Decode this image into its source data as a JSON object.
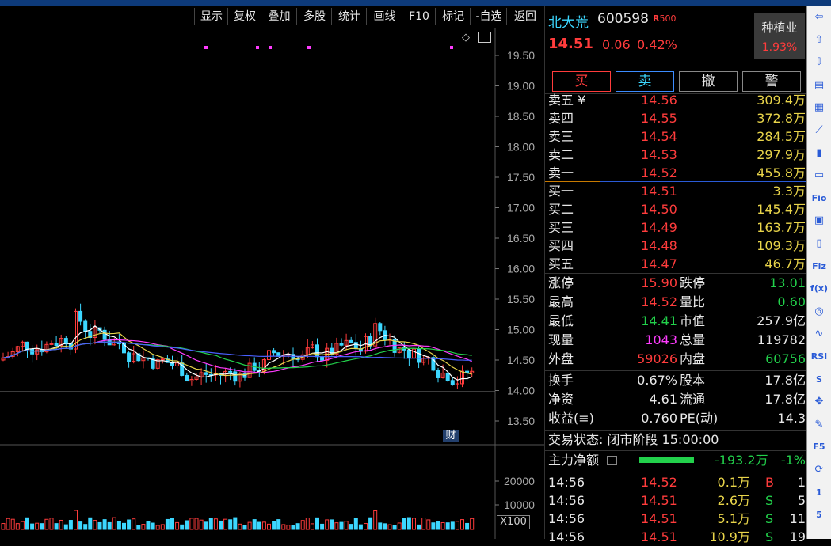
{
  "toolbar": [
    "显示",
    "复权",
    "叠加",
    "多股",
    "统计",
    "画线",
    "F10",
    "标记",
    "-自选",
    "返回"
  ],
  "price_axis": [
    "19.50",
    "19.00",
    "18.50",
    "18.00",
    "17.50",
    "17.00",
    "16.50",
    "16.00",
    "15.50",
    "15.00",
    "14.50",
    "14.00",
    "13.50"
  ],
  "volume_axis": [
    "20000",
    "10000"
  ],
  "volume_unit": "X100",
  "finance_tag": "财",
  "stock": {
    "name": "北大荒",
    "code": "600598",
    "badge": "R",
    "badge_num": "500",
    "price": "14.51",
    "change": "0.06",
    "pct": "0.42%"
  },
  "sector": {
    "name": "种植业",
    "pct": "1.93%"
  },
  "buttons": {
    "buy": "买",
    "sell": "卖",
    "cancel": "撤",
    "alert": "警"
  },
  "asks": [
    {
      "label": "卖五 ¥",
      "price": "14.56",
      "vol": "309.4万"
    },
    {
      "label": "卖四",
      "price": "14.55",
      "vol": "372.8万"
    },
    {
      "label": "卖三",
      "price": "14.54",
      "vol": "284.5万"
    },
    {
      "label": "卖二",
      "price": "14.53",
      "vol": "297.9万"
    },
    {
      "label": "卖一",
      "price": "14.52",
      "vol": "455.8万"
    }
  ],
  "bids": [
    {
      "label": "买一",
      "price": "14.51",
      "vol": "3.3万"
    },
    {
      "label": "买二",
      "price": "14.50",
      "vol": "145.4万"
    },
    {
      "label": "买三",
      "price": "14.49",
      "vol": "163.7万"
    },
    {
      "label": "买四",
      "price": "14.48",
      "vol": "109.3万"
    },
    {
      "label": "买五",
      "price": "14.47",
      "vol": "46.7万"
    }
  ],
  "stats": [
    {
      "l1": "涨停",
      "v1": "15.90",
      "c1": "red",
      "l2": "跌停",
      "v2": "13.01",
      "c2": "green"
    },
    {
      "l1": "最高",
      "v1": "14.52",
      "c1": "red",
      "l2": "量比",
      "v2": "0.60",
      "c2": "green"
    },
    {
      "l1": "最低",
      "v1": "14.41",
      "c1": "green",
      "l2": "市值",
      "v2": "257.9亿",
      "c2": "white"
    },
    {
      "l1": "现量",
      "v1": "1043",
      "c1": "magenta",
      "l2": "总量",
      "v2": "119782",
      "c2": "white"
    },
    {
      "l1": "外盘",
      "v1": "59026",
      "c1": "red",
      "l2": "内盘",
      "v2": "60756",
      "c2": "green"
    }
  ],
  "stats2": [
    {
      "l1": "换手",
      "v1": "0.67%",
      "l2": "股本",
      "v2": "17.8亿"
    },
    {
      "l1": "净资",
      "v1": "4.61",
      "l2": "流通",
      "v2": "17.8亿"
    },
    {
      "l1": "收益(≡)",
      "v1": "0.760",
      "l2": "PE(动)",
      "v2": "14.3"
    }
  ],
  "trade_status": "交易状态: 闭市阶段 15:00:00",
  "main_flow": {
    "label": "主力净额",
    "value": "-193.2万",
    "pct": "-1%"
  },
  "ticks": [
    {
      "time": "14:56",
      "price": "14.52",
      "vol": "0.1万",
      "side": "B",
      "num": "1"
    },
    {
      "time": "14:56",
      "price": "14.51",
      "vol": "2.6万",
      "side": "S",
      "num": "5"
    },
    {
      "time": "14:56",
      "price": "14.51",
      "vol": "5.1万",
      "side": "S",
      "num": "11"
    },
    {
      "time": "14:56",
      "price": "14.51",
      "vol": "10.9万",
      "side": "S",
      "num": "19"
    }
  ],
  "side_icons": [
    "arrow-left-icon",
    "arrow-up-icon",
    "arrow-down-icon",
    "list-icon",
    "grid-icon",
    "line-chart-icon",
    "candle-icon",
    "document-icon",
    "f10-icon",
    "table-icon",
    "orange-doc-icon",
    "f12-icon",
    "fx-icon",
    "circle-icon",
    "wave-icon",
    "rsi-icon",
    "s-icon",
    "move-icon",
    "pencil-icon",
    "f5-icon",
    "refresh-icon",
    "one-icon",
    "five-icon"
  ],
  "side_labels": {
    "f10": "Fio",
    "f12": "Fiz",
    "rsi": "RSI",
    "s": "S",
    "f5": "F5",
    "fx": "f(x)",
    "one": "1",
    "five": "5"
  },
  "colors": {
    "up": "#ff3c3c",
    "down": "#3cd7ff",
    "ma5": "#ffffff",
    "ma10": "#e8d44a",
    "ma20": "#ff3cff",
    "ma30": "#22d14b",
    "ma60": "#4a60ff"
  }
}
